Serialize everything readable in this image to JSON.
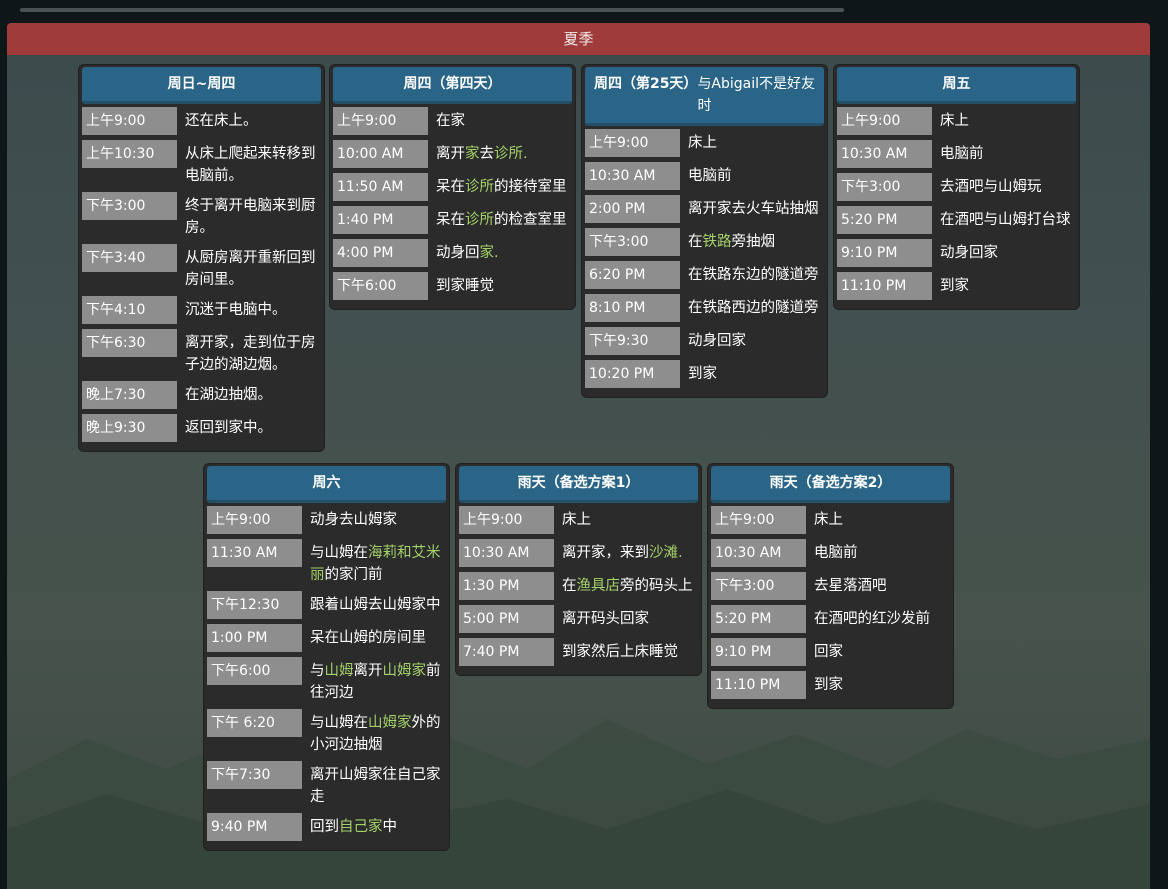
{
  "season": {
    "title": "夏季"
  },
  "colors": {
    "season_bar": "#9f3c3b",
    "card_header": "#2a6587",
    "card_body": "#2b2b2b",
    "time_chip": "#8e8e8e",
    "link_green": "#a4d16a"
  },
  "cards": [
    {
      "title": "周日~周四",
      "title_suffix": "",
      "rows": [
        {
          "time": "上午9:00",
          "desc": [
            {
              "t": "还在床上。"
            }
          ]
        },
        {
          "time": "上午10:30",
          "desc": [
            {
              "t": "从床上爬起来转移到电脑前。"
            }
          ]
        },
        {
          "time": "下午3:00",
          "desc": [
            {
              "t": "终于离开电脑来到厨房。"
            }
          ]
        },
        {
          "time": "下午3:40",
          "desc": [
            {
              "t": "从厨房离开重新回到房间里。"
            }
          ]
        },
        {
          "time": "下午4:10",
          "desc": [
            {
              "t": "沉迷于电脑中。"
            }
          ]
        },
        {
          "time": "下午6:30",
          "desc": [
            {
              "t": "离开家，走到位于房子边的湖边烟。"
            }
          ]
        },
        {
          "time": "晚上7:30",
          "desc": [
            {
              "t": "在湖边抽烟。"
            }
          ]
        },
        {
          "time": "晚上9:30",
          "desc": [
            {
              "t": "返回到家中。"
            }
          ]
        }
      ]
    },
    {
      "title": "周四（第四天）",
      "title_suffix": "",
      "rows": [
        {
          "time": "上午9:00",
          "desc": [
            {
              "t": "在家"
            }
          ]
        },
        {
          "time": "10:00 AM",
          "desc": [
            {
              "t": "离开"
            },
            {
              "t": "家",
              "hl": true
            },
            {
              "t": "去"
            },
            {
              "t": "诊所.",
              "hl": true
            }
          ]
        },
        {
          "time": "11:50 AM",
          "desc": [
            {
              "t": "呆在"
            },
            {
              "t": "诊所",
              "hl": true
            },
            {
              "t": "的接待室里"
            }
          ]
        },
        {
          "time": "1:40 PM",
          "desc": [
            {
              "t": "呆在"
            },
            {
              "t": "诊所",
              "hl": true
            },
            {
              "t": "的检查室里"
            }
          ]
        },
        {
          "time": "4:00 PM",
          "desc": [
            {
              "t": "动身回"
            },
            {
              "t": "家.",
              "hl": true
            }
          ]
        },
        {
          "time": "下午6:00",
          "desc": [
            {
              "t": "到家睡觉"
            }
          ]
        }
      ]
    },
    {
      "title": "周四（第25天）",
      "title_suffix": "与Abigail不是好友时",
      "rows": [
        {
          "time": "上午9:00",
          "desc": [
            {
              "t": "床上"
            }
          ]
        },
        {
          "time": "10:30 AM",
          "desc": [
            {
              "t": "电脑前"
            }
          ]
        },
        {
          "time": "2:00 PM",
          "desc": [
            {
              "t": "离开家去火车站抽烟"
            }
          ]
        },
        {
          "time": "下午3:00",
          "desc": [
            {
              "t": "在"
            },
            {
              "t": "铁路",
              "hl": true
            },
            {
              "t": "旁抽烟"
            }
          ]
        },
        {
          "time": "6:20 PM",
          "desc": [
            {
              "t": "在铁路东边的隧道旁"
            }
          ]
        },
        {
          "time": "8:10 PM",
          "desc": [
            {
              "t": "在铁路西边的隧道旁"
            }
          ]
        },
        {
          "time": "下午9:30",
          "desc": [
            {
              "t": "动身回家"
            }
          ]
        },
        {
          "time": "10:20 PM",
          "desc": [
            {
              "t": "到家"
            }
          ]
        }
      ]
    },
    {
      "title": "周五",
      "title_suffix": "",
      "rows": [
        {
          "time": "上午9:00",
          "desc": [
            {
              "t": "床上"
            }
          ]
        },
        {
          "time": "10:30 AM",
          "desc": [
            {
              "t": "电脑前"
            }
          ]
        },
        {
          "time": "下午3:00",
          "desc": [
            {
              "t": "去酒吧与山姆玩"
            }
          ]
        },
        {
          "time": "5:20 PM",
          "desc": [
            {
              "t": "在酒吧与山姆打台球"
            }
          ]
        },
        {
          "time": "9:10 PM",
          "desc": [
            {
              "t": "动身回家"
            }
          ]
        },
        {
          "time": "11:10 PM",
          "desc": [
            {
              "t": "到家"
            }
          ]
        }
      ]
    },
    {
      "title": "周六",
      "title_suffix": "",
      "rows": [
        {
          "time": "上午9:00",
          "desc": [
            {
              "t": "动身去山姆家"
            }
          ]
        },
        {
          "time": "11:30 AM",
          "desc": [
            {
              "t": "与山姆在"
            },
            {
              "t": "海莉和艾米丽",
              "hl": true
            },
            {
              "t": "的家门前"
            }
          ]
        },
        {
          "time": "下午12:30",
          "desc": [
            {
              "t": "跟着山姆去山姆家中"
            }
          ]
        },
        {
          "time": "1:00 PM",
          "desc": [
            {
              "t": "呆在山姆的房间里"
            }
          ]
        },
        {
          "time": "下午6:00",
          "desc": [
            {
              "t": "与"
            },
            {
              "t": "山姆",
              "hl": true
            },
            {
              "t": "离开"
            },
            {
              "t": "山姆家",
              "hl": true
            },
            {
              "t": "前往河边"
            }
          ]
        },
        {
          "time": "下午 6:20",
          "desc": [
            {
              "t": "与山姆在"
            },
            {
              "t": "山姆家",
              "hl": true
            },
            {
              "t": "外的小河边抽烟"
            }
          ]
        },
        {
          "time": "下午7:30",
          "desc": [
            {
              "t": "离开山姆家往自己家走"
            }
          ]
        },
        {
          "time": "9:40 PM",
          "desc": [
            {
              "t": "回到"
            },
            {
              "t": "自己家",
              "hl": true
            },
            {
              "t": "中"
            }
          ]
        }
      ]
    },
    {
      "title": "雨天（备选方案1）",
      "title_suffix": "",
      "rows": [
        {
          "time": "上午9:00",
          "desc": [
            {
              "t": "床上"
            }
          ]
        },
        {
          "time": "10:30 AM",
          "desc": [
            {
              "t": "离开家，来到"
            },
            {
              "t": "沙滩.",
              "hl": true
            }
          ]
        },
        {
          "time": "1:30 PM",
          "desc": [
            {
              "t": "在"
            },
            {
              "t": "渔具店",
              "hl": true
            },
            {
              "t": "旁的码头上"
            }
          ]
        },
        {
          "time": "5:00 PM",
          "desc": [
            {
              "t": "离开码头回家"
            }
          ]
        },
        {
          "time": "7:40 PM",
          "desc": [
            {
              "t": "到家然后上床睡觉"
            }
          ]
        }
      ]
    },
    {
      "title": "雨天（备选方案2）",
      "title_suffix": "",
      "rows": [
        {
          "time": "上午9:00",
          "desc": [
            {
              "t": "床上"
            }
          ]
        },
        {
          "time": "10:30 AM",
          "desc": [
            {
              "t": "电脑前"
            }
          ]
        },
        {
          "time": "下午3:00",
          "desc": [
            {
              "t": "去星落酒吧"
            }
          ]
        },
        {
          "time": "5:20 PM",
          "desc": [
            {
              "t": "在酒吧的红沙发前"
            }
          ]
        },
        {
          "time": "9:10 PM",
          "desc": [
            {
              "t": "回家"
            }
          ]
        },
        {
          "time": "11:10 PM",
          "desc": [
            {
              "t": "到家"
            }
          ]
        }
      ]
    }
  ]
}
